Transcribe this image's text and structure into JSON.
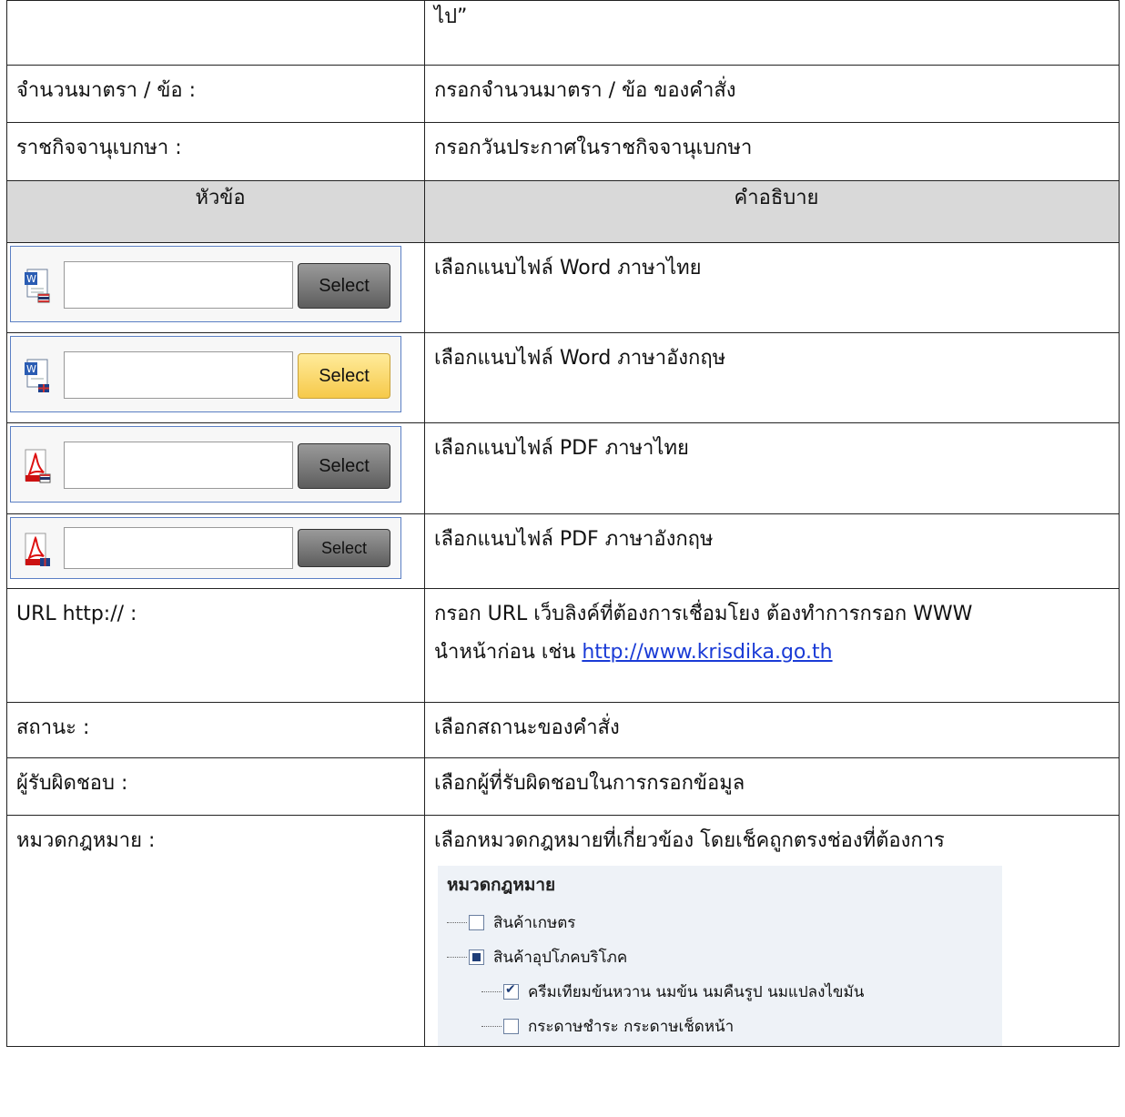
{
  "rows_top": [
    {
      "label": "",
      "desc": "ไป”"
    },
    {
      "label": "จำนวนมาตรา / ข้อ :",
      "desc": "กรอกจำนวนมาตรา / ข้อ ของคำสั่ง"
    },
    {
      "label": "ราชกิจจานุเบกษา :",
      "desc": "กรอกวันประกาศในราชกิจจานุเบกษา"
    }
  ],
  "header": {
    "col1": "หัวข้อ",
    "col2": "คำอธิบาย"
  },
  "uploads": [
    {
      "icon": "word-thai-icon",
      "button": "Select",
      "desc": "เลือกแนบไฟล์ Word ภาษาไทย"
    },
    {
      "icon": "word-english-icon",
      "button": "Select",
      "desc": "เลือกแนบไฟล์ Word ภาษาอังกฤษ"
    },
    {
      "icon": "pdf-thai-icon",
      "button": "Select",
      "desc": "เลือกแนบไฟล์ PDF ภาษาไทย"
    },
    {
      "icon": "pdf-english-icon",
      "button": "Select",
      "desc": "เลือกแนบไฟล์ PDF ภาษาอังกฤษ"
    }
  ],
  "url_row": {
    "label": "URL http:// :",
    "desc_line1": "กรอก URL เว็บลิงค์ที่ต้องการเชื่อมโยง ต้องทำการกรอก WWW",
    "desc_line2_prefix": "นำหน้าก่อน เช่น ",
    "link": "http://www.krisdika.go.th"
  },
  "rows_bottom": [
    {
      "label": "สถานะ :",
      "desc": "เลือกสถานะของคำสั่ง"
    },
    {
      "label": "ผู้รับผิดชอบ :",
      "desc": "เลือกผู้ที่รับผิดชอบในการกรอกข้อมูล"
    }
  ],
  "category_row": {
    "label": "หมวดกฎหมาย :",
    "desc": "เลือกหมวดกฎหมายที่เกี่ยวข้อง โดยเช็คถูกตรงช่องที่ต้องการ",
    "tree": {
      "title": "หมวดกฎหมาย",
      "items": [
        {
          "label": "สินค้าเกษตร",
          "state": "unchecked"
        },
        {
          "label": "สินค้าอุปโภคบริโภค",
          "state": "partial"
        },
        {
          "label": "ครีมเทียมข้นหวาน นมข้น นมคืนรูป นมแปลงไขมัน",
          "state": "checked"
        },
        {
          "label": "กระดาษชำระ กระดาษเช็ดหน้า",
          "state": "unchecked"
        }
      ]
    }
  }
}
